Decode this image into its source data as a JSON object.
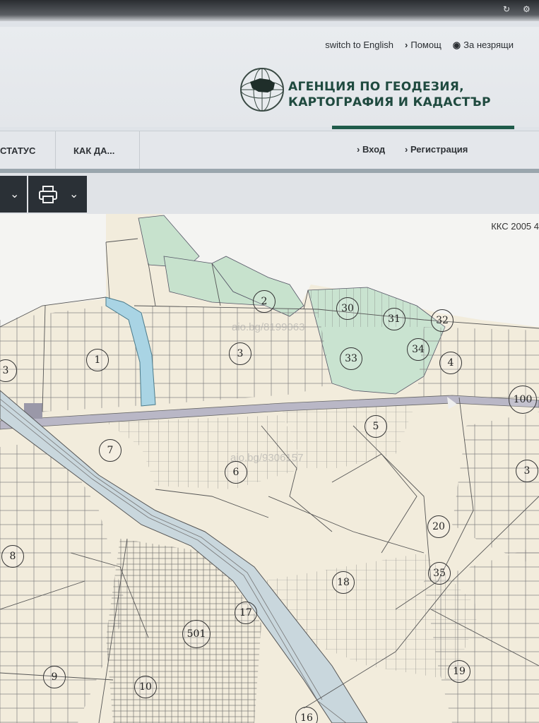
{
  "header": {
    "top_links": [
      {
        "label": "switch to English",
        "chevron": false
      },
      {
        "label": "Помощ",
        "chevron": true
      },
      {
        "label": "За незрящи",
        "chevron": false,
        "icon": "eye-icon"
      }
    ],
    "agency_line1": "АГЕНЦИЯ ПО ГЕОДЕЗИЯ,",
    "agency_line2": "КАРТОГРАФИЯ И КАДАСТЪР",
    "logo_icon": "globe-bulgaria-logo"
  },
  "nav": {
    "items": [
      "СТАТУС",
      "КАК ДА..."
    ],
    "login": "Вход",
    "register": "Регистрация"
  },
  "toolbar": {
    "tools": [
      {
        "icon": "chevron-down-icon"
      },
      {
        "icon": "print-icon"
      },
      {
        "icon": "chevron-down-icon"
      }
    ]
  },
  "map": {
    "crs_label": "ККС 2005 4",
    "watermarks": [
      "aio.bg/8199063",
      "aio.bg/9306157"
    ],
    "parcels": [
      "3",
      "1",
      "2",
      "3",
      "30",
      "31",
      "32",
      "33",
      "34",
      "4",
      "100",
      "5",
      "7",
      "6",
      "3",
      "8",
      "20",
      "35",
      "18",
      "17",
      "501",
      "9",
      "10",
      "19",
      "16"
    ]
  },
  "colors": {
    "brand_green": "#1f5b4a",
    "map_background": "#f3efe2",
    "forest": "#c9e3d0",
    "water": "#a9d4e4",
    "road": "#b9b7c6"
  }
}
